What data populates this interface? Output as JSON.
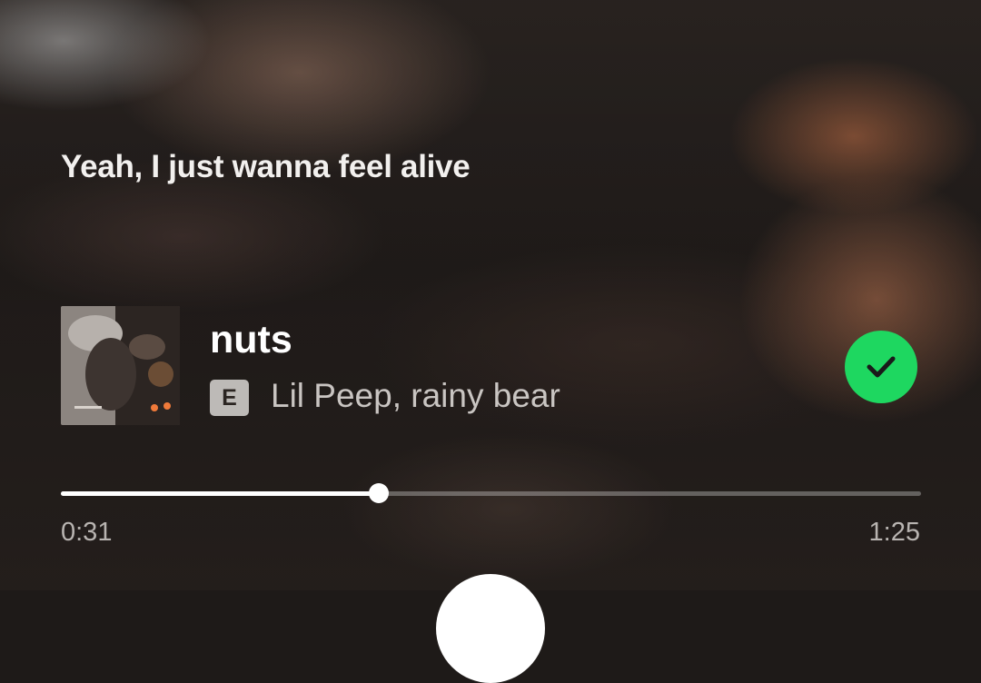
{
  "lyrics": {
    "current_line": "Yeah, I just wanna feel alive"
  },
  "track": {
    "title": "nuts",
    "explicit_badge": "E",
    "artists": "Lil Peep, rainy bear",
    "cover_icon": "album-cover",
    "liked": true,
    "liked_icon": "check-icon"
  },
  "playback": {
    "elapsed": "0:31",
    "duration": "1:25",
    "progress_fraction": 0.37
  },
  "colors": {
    "accent_green": "#1ed760"
  }
}
